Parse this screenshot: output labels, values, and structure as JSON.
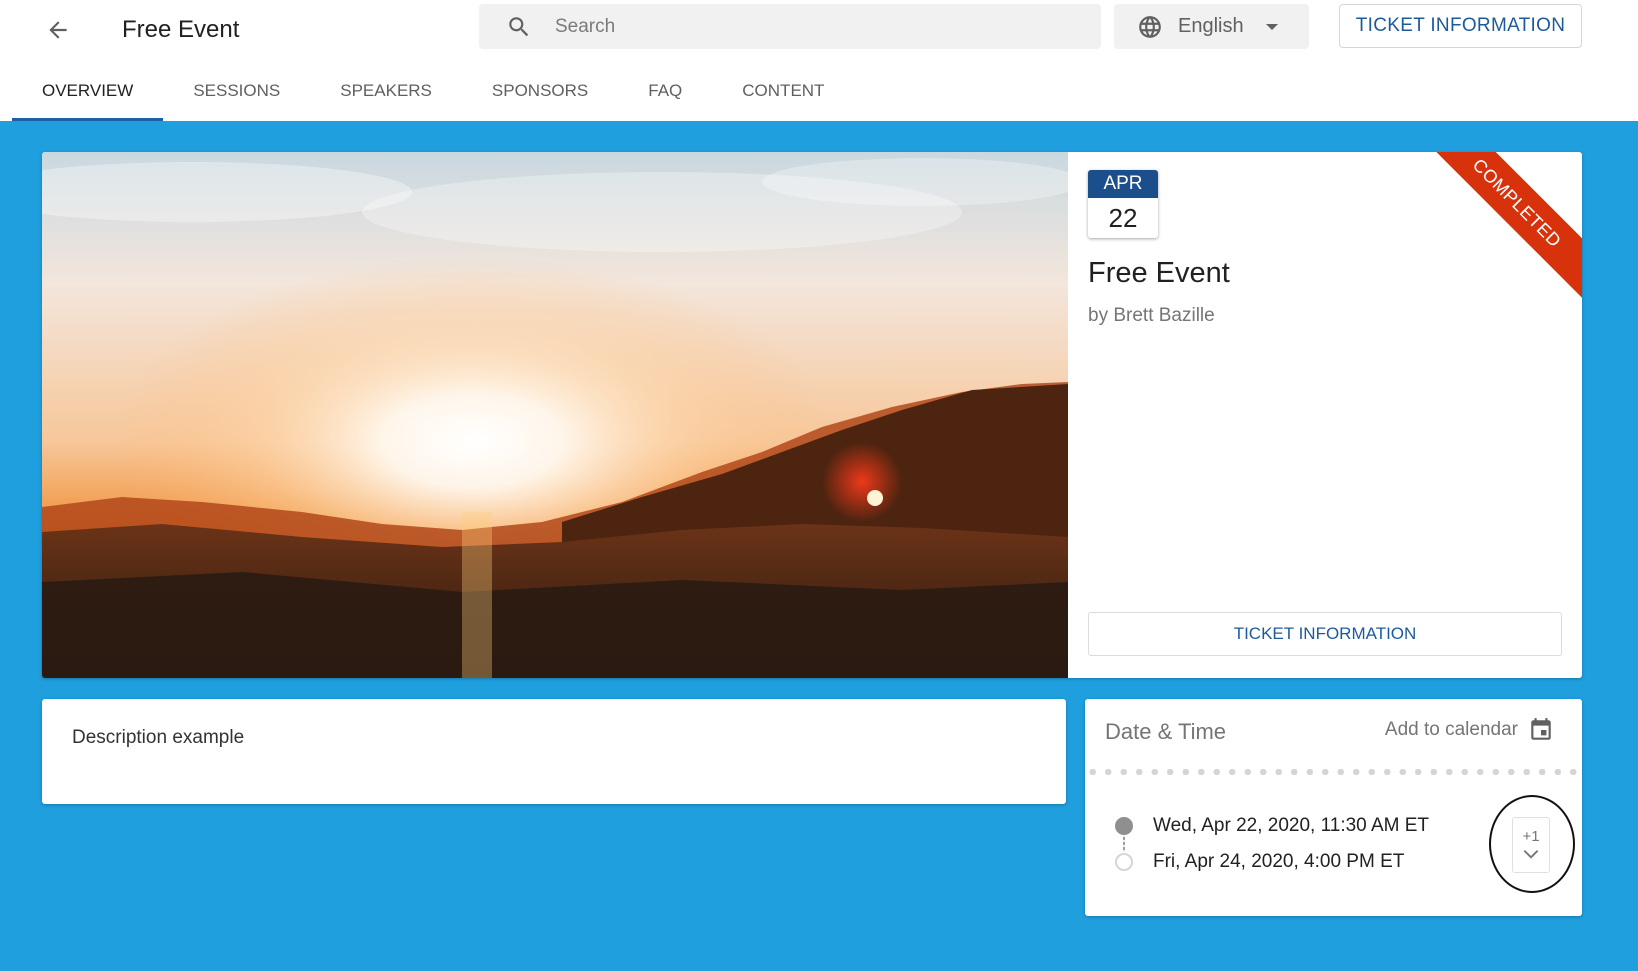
{
  "header": {
    "title": "Free Event",
    "search_placeholder": "Search",
    "language": "English",
    "ticket_button": "TICKET INFORMATION"
  },
  "tabs": [
    {
      "label": "OVERVIEW",
      "active": true
    },
    {
      "label": "SESSIONS",
      "active": false
    },
    {
      "label": "SPEAKERS",
      "active": false
    },
    {
      "label": "SPONSORS",
      "active": false
    },
    {
      "label": "FAQ",
      "active": false
    },
    {
      "label": "CONTENT",
      "active": false
    }
  ],
  "event": {
    "month": "APR",
    "day": "22",
    "name": "Free Event",
    "organizer": "by Brett Bazille",
    "status": "COMPLETED",
    "ticket_button": "TICKET INFORMATION"
  },
  "description": {
    "text": "Description example"
  },
  "datetime": {
    "title": "Date & Time",
    "add_to_calendar": "Add to calendar",
    "start": "Wed, Apr 22, 2020, 11:30 AM ET",
    "end": "Fri, Apr 24, 2020, 4:00 PM ET",
    "more_count": "+1"
  },
  "colors": {
    "background": "#1f9fde",
    "primary": "#1d5a9c",
    "badge_month": "#1b4f8c",
    "ribbon": "#d8320d"
  },
  "icons": {
    "back": "arrow-left-icon",
    "search": "search-icon",
    "language": "globe-icon",
    "calendar": "calendar-icon",
    "expand": "chevron-down-icon"
  }
}
